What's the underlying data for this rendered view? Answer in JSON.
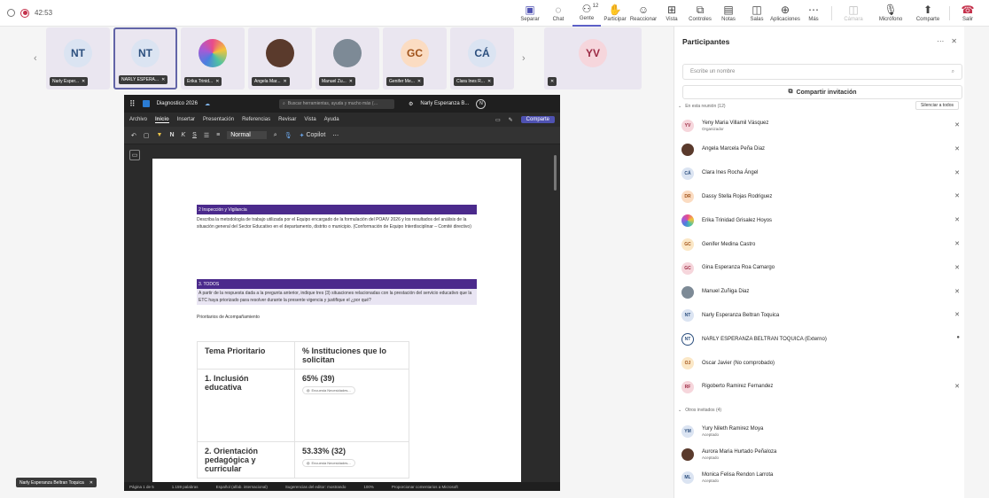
{
  "topbar": {
    "timer": "42:53",
    "buttons": [
      {
        "label": "Separar",
        "icon": "pop-out-icon",
        "glyph": "▣",
        "state": "primary"
      },
      {
        "label": "Chat",
        "icon": "chat-icon",
        "glyph": "◌"
      },
      {
        "label": "Gente",
        "icon": "people-icon",
        "glyph": "⚇",
        "badge": "12",
        "state": "active"
      },
      {
        "label": "Participar",
        "icon": "raise-hand-icon",
        "glyph": "✋"
      },
      {
        "label": "Reaccionar",
        "icon": "emoji-icon",
        "glyph": "☺"
      },
      {
        "label": "Vista",
        "icon": "view-icon",
        "glyph": "⊞"
      },
      {
        "label": "Controles",
        "icon": "controls-icon",
        "glyph": "⧉"
      },
      {
        "label": "Notas",
        "icon": "notes-icon",
        "glyph": "▤"
      },
      {
        "label": "Salas",
        "icon": "rooms-icon",
        "glyph": "◫"
      },
      {
        "label": "Aplicaciones",
        "icon": "apps-icon",
        "glyph": "⊕"
      },
      {
        "label": "Más",
        "icon": "more-icon",
        "glyph": "⋯"
      }
    ],
    "camera_label": "Cámara",
    "mic_label": "Micrófono",
    "share_label": "Comparte",
    "leave_label": "Salir"
  },
  "strip": {
    "tiles": [
      {
        "initials": "NT",
        "label": "Narly Esper...",
        "bg": "#dbe4f2",
        "fg": "#2c4f7e"
      },
      {
        "initials": "NT",
        "label": "NARLY ESPERA...",
        "bg": "#dbe4f2",
        "fg": "#2c4f7e",
        "selected": true
      },
      {
        "initials": "",
        "label": "Erika Trinid...",
        "bg": "#ffffff",
        "image": "colorful-logo"
      },
      {
        "initials": "",
        "label": "Angela Mar...",
        "bg": "#f3e4e7",
        "image": "photo-woman"
      },
      {
        "initials": "",
        "label": "Manuel Zu...",
        "bg": "#e6e8ee",
        "image": "photo-man"
      },
      {
        "initials": "GC",
        "label": "Genifer Me...",
        "bg": "#fbdcc2",
        "fg": "#a0521a"
      },
      {
        "initials": "CÁ",
        "label": "Clara Ines R...",
        "bg": "#dbe4f2",
        "fg": "#2c4f7e"
      },
      {
        "initials": "YV",
        "label": "",
        "bg": "#f6d6dc",
        "fg": "#9c2b44"
      }
    ]
  },
  "word": {
    "doc_title": "Diagnostico 2026",
    "search_placeholder": "Buscar herramientas, ayuda y mucho más (…",
    "user_name": "Narly Esperanza B...",
    "user_initial": "N",
    "menu": [
      "Archivo",
      "Inicio",
      "Insertar",
      "Presentación",
      "Referencias",
      "Revisar",
      "Vista",
      "Ayuda"
    ],
    "active_menu": "Inicio",
    "share_btn": "Comparte",
    "style_value": "Normal",
    "copilot": "Copilot",
    "ribbon_bold": "N",
    "ribbon_italic": "K",
    "ribbon_underline": "S",
    "section1_title": "2 Inspección y Vigilancia",
    "section1_text": "Describa la metodología de trabajo utilizada por el Equipo encargado de la formulación del POAIV 2026 y los resultados del análisis de la situación general del Sector Educativo en el departamento, distrito o municipio. (Conformación de Equipo Interdisciplinar – Comité directivo)",
    "section2_title": "3. TODOS",
    "section2_text": "A partir de la respuesta dada a la pregunta anterior, indique tres (3) situaciones relacionadas con la prestación del servicio educativo que la ETC haya priorizado para resolver durante la presente vigencia y justifique el ¿por qué?",
    "subheading": "Prioritarios de Acompañamiento",
    "table_headers": [
      "Tema Prioritario",
      "% Instituciones que lo solicitan"
    ],
    "table_rows": [
      {
        "topic": "1. Inclusión educativa",
        "value": "65% (39)",
        "chip": "Encuesta Necesidades..."
      },
      {
        "topic": "2. Orientación pedagógica y curricular",
        "value": "53.33% (32)",
        "chip": "Encuesta Necesidades..."
      }
    ],
    "status": [
      "Página 1 de 5",
      "1.159 palabras",
      "Español (alfab. internacional)",
      "Sugerencias del editor: mostrando",
      "100%",
      "Proporcionar comentarios a Microsoft"
    ]
  },
  "panel": {
    "title": "Participantes",
    "search_placeholder": "Escribe un nombre",
    "invite_label": "Compartir invitación",
    "in_meeting_label": "En esta reunión (12)",
    "mute_all_label": "Silenciar a todos",
    "participants": [
      {
        "initials": "YV",
        "name": "Yeny Maria Villamil Vásquez",
        "sub": "Organizador",
        "bg": "#f6d6dc",
        "fg": "#9c2b44",
        "mic": "muted"
      },
      {
        "initials": "",
        "image": "photo-woman",
        "name": "Angela Marcela Peña Diaz",
        "sub": "",
        "bg": "#f3e4e7",
        "fg": "#333",
        "mic": "muted"
      },
      {
        "initials": "CÁ",
        "name": "Clara Ines Rocha Ángel",
        "sub": "",
        "bg": "#dbe4f2",
        "fg": "#2c4f7e",
        "mic": "muted"
      },
      {
        "initials": "DR",
        "name": "Dassy Stella Rojas Rodriguez",
        "sub": "",
        "bg": "#fbdcc2",
        "fg": "#a0521a",
        "mic": "muted"
      },
      {
        "initials": "",
        "image": "colorful-logo",
        "name": "Erika Trinidad Grisalez Hoyos",
        "sub": "",
        "bg": "#ffffff",
        "fg": "#333",
        "mic": "muted"
      },
      {
        "initials": "GC",
        "name": "Genifer Medina Castro",
        "sub": "",
        "bg": "#fbe7c6",
        "fg": "#a0521a",
        "mic": "muted"
      },
      {
        "initials": "GC",
        "name": "Gina Esperanza Roa Camargo",
        "sub": "",
        "bg": "#f6d6dc",
        "fg": "#9c2b44",
        "mic": "muted"
      },
      {
        "initials": "",
        "image": "photo-man",
        "name": "Manuel Zuñiga Diaz",
        "sub": "",
        "bg": "#e6e8ee",
        "fg": "#333",
        "mic": "muted"
      },
      {
        "initials": "NT",
        "name": "Narly Esperanza Beltran Toquica",
        "sub": "",
        "bg": "#dbe4f2",
        "fg": "#2c4f7e",
        "mic": "muted"
      },
      {
        "initials": "NT",
        "name": "NARLY ESPERANZA BELTRAN TOQUICA (Externo)",
        "sub": "",
        "bg": "#ffffff",
        "fg": "#2c4f7e",
        "mic": "on",
        "ring": true
      },
      {
        "initials": "OJ",
        "name": "Oscar Javier (No comprobado)",
        "sub": "",
        "bg": "#fbe7c6",
        "fg": "#a0521a",
        "mic": "none"
      },
      {
        "initials": "RF",
        "name": "Rigoberto Ramirez Fernandez",
        "sub": "",
        "bg": "#f6d6dc",
        "fg": "#9c2b44",
        "mic": "muted"
      }
    ],
    "others_label": "Otros invitados (4)",
    "others": [
      {
        "initials": "YM",
        "name": "Yury Nileth Ramirez Moya",
        "sub": "Aceptado",
        "bg": "#dbe4f2",
        "fg": "#2c4f7e"
      },
      {
        "initials": "",
        "image": "photo-woman",
        "name": "Aurora Maria Hurtado Peñaloza",
        "sub": "Aceptado",
        "bg": "#f3e4e7",
        "fg": "#333"
      },
      {
        "initials": "ML",
        "name": "Monica Felisa Rendon Larrota",
        "sub": "Aceptado",
        "bg": "#dbe4f2",
        "fg": "#2c4f7e"
      }
    ]
  },
  "bottom_name_tag": "Narly Esperanza Beltran Toquica"
}
